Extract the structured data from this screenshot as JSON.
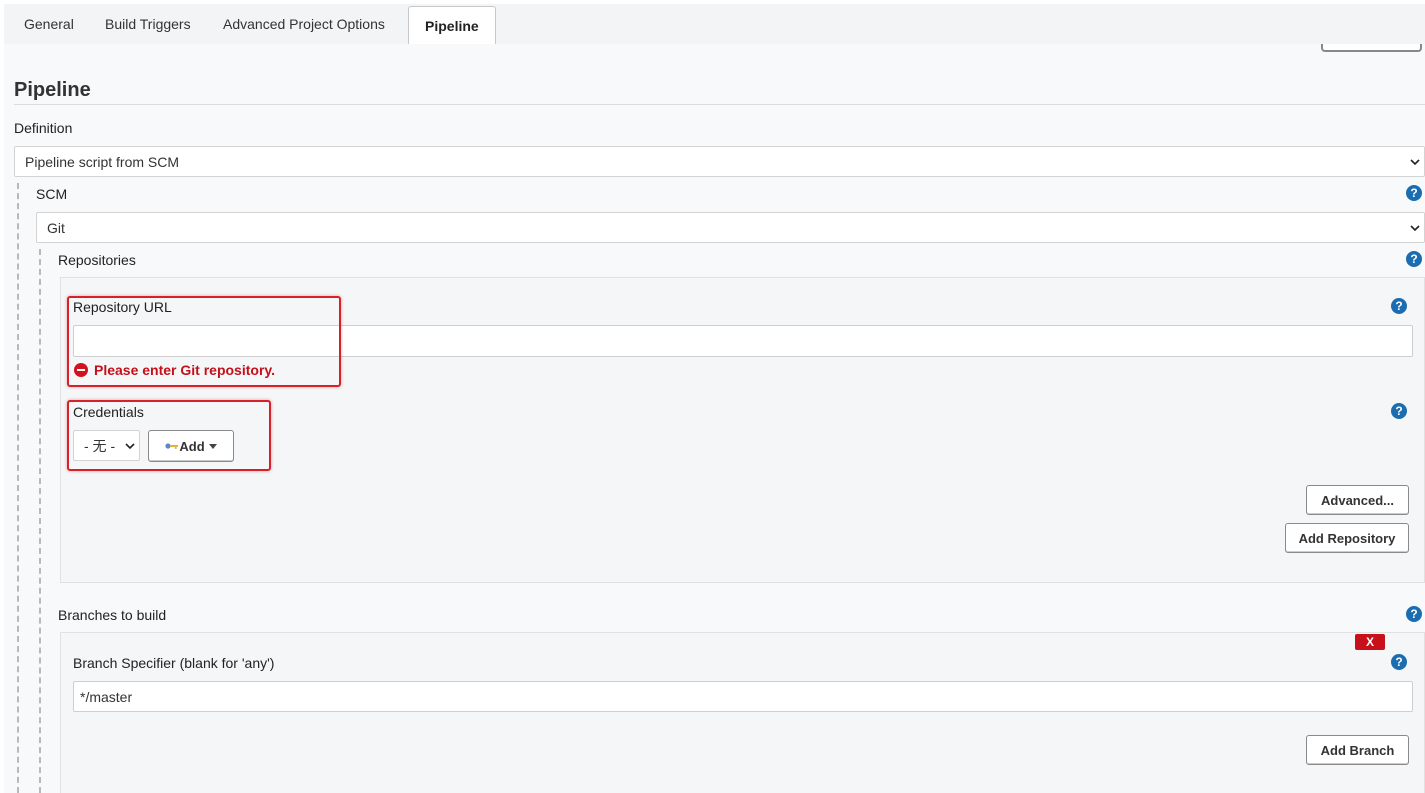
{
  "tabs": [
    {
      "label": "General"
    },
    {
      "label": "Build Triggers"
    },
    {
      "label": "Advanced Project Options"
    },
    {
      "label": "Pipeline",
      "active": true
    }
  ],
  "pipeline": {
    "title": "Pipeline",
    "definition_label": "Definition",
    "definition_value": "Pipeline script from SCM",
    "scm_label": "SCM",
    "scm_value": "Git",
    "repositories_label": "Repositories",
    "repo_url_label": "Repository URL",
    "repo_url_value": "",
    "repo_url_error": "Please enter Git repository.",
    "credentials_label": "Credentials",
    "credentials_value": "- 无 -",
    "credentials_add": "Add",
    "advanced_button": "Advanced...",
    "add_repository_button": "Add Repository",
    "branches_label": "Branches to build",
    "branch_specifier_label": "Branch Specifier (blank for 'any')",
    "branch_specifier_value": "*/master",
    "delete_branch": "X",
    "add_branch_button": "Add Branch"
  },
  "help_glyph": "?",
  "colors": {
    "help_icon": "#1b6db0",
    "error_text": "#c4101a",
    "highlight_box": "#d6202a",
    "delete_button": "#c8101a"
  }
}
